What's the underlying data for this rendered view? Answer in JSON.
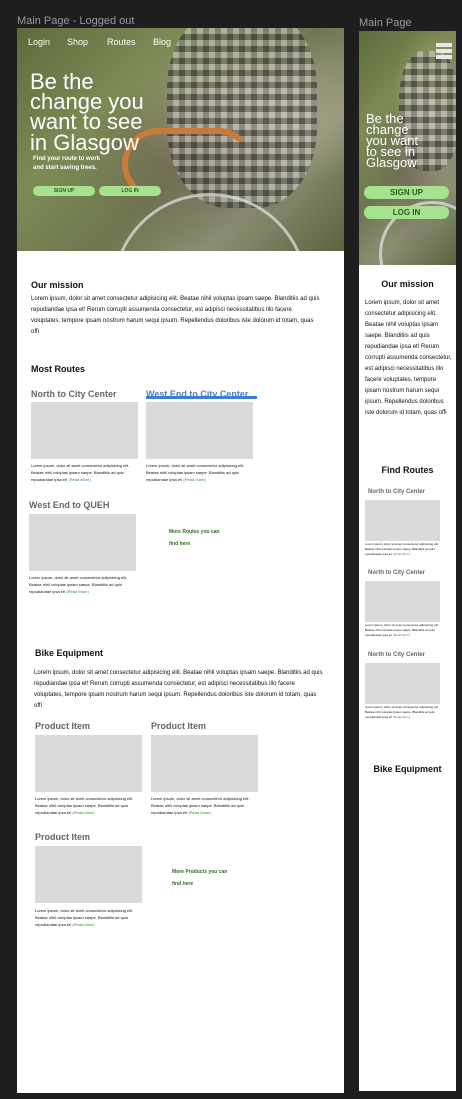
{
  "desktop": {
    "frame_label": "Main Page - Logged out",
    "nav": [
      "Login",
      "Shop",
      "Routes",
      "Blog"
    ],
    "hero": {
      "title_lines": [
        "Be the",
        "change you",
        "want to see",
        "in Glasgow"
      ],
      "subtitle_lines": [
        "Find your route to work",
        "and start saving trees."
      ],
      "signup": "SIGN UP",
      "login": "LOG IN"
    },
    "mission": {
      "title": "Our mission",
      "text": "Lorem ipsum, dolor sit amet consectetur adipisicing elit. Beatae nihil voluptas ipsam saepe. Blanditiis ad quis repudiandae ipsa et! Rerum corrupti assumenda consectetur, est adipisci necessitatibus illo facere voluptates, tempore ipsam nostrum harum sequi ipsum. Repellendus doloribus iste dolorum id totam, quas offi"
    },
    "routes": {
      "title": "Most Routes",
      "cards": [
        {
          "title": "North to City Center",
          "text": "Lorem ipsum, dolor sit amet consectetur adipisicing elit. Beatae nihil voluptas ipsam saepe. Blanditiis ad quis repudiandae ipsa et! ",
          "read_more": "(Read More)"
        },
        {
          "title": "West End to City Center",
          "text": "Lorem ipsum, dolor sit amet consectetur adipisicing elit. Beatae nihil voluptas ipsam saepe. Blanditiis ad quis repudiandae ipsa et! ",
          "read_more": "(Read More)"
        },
        {
          "title": "West End to QUEH",
          "text": "Lorem ipsum, dolor sit amet consectetur adipisicing elit. Beatae nihil voluptas ipsam saepe. Blanditiis ad quis repudiandae ipsa et! ",
          "read_more": "(Read More)"
        }
      ],
      "more_lines": [
        "More Routes you can",
        "find here"
      ]
    },
    "equipment": {
      "title": "Bike Equipment",
      "text": "Lorem ipsum, dolor sit amet consectetur adipisicing elit. Beatae nihil voluptas ipsam saepe. Blanditiis ad quis repudiandae ipsa et! Rerum corrupti assumenda consectetur, est adipisci necessitatibus illo facere voluptates, tempore ipsam nostrum harum sequi ipsum. Repellendus doloribus iste dolorum id totam, quas offi",
      "cards": [
        {
          "title": "Product Item",
          "text": "Lorem ipsum, dolor sit amet consectetur adipisicing elit. Beatae nihil voluptas ipsam saepe. Blanditiis ad quis repudiandae ipsa et! ",
          "read_more": "(Read More)"
        },
        {
          "title": "Product Item",
          "text": "Lorem ipsum, dolor sit amet consectetur adipisicing elit. Beatae nihil voluptas ipsam saepe. Blanditiis ad quis repudiandae ipsa et! ",
          "read_more": "(Read More)"
        },
        {
          "title": "Product Item",
          "text": "Lorem ipsum, dolor sit amet consectetur adipisicing elit. Beatae nihil voluptas ipsam saepe. Blanditiis ad quis repudiandae ipsa et! ",
          "read_more": "(Read More)"
        }
      ],
      "more_lines": [
        "More Products you can",
        "find here"
      ]
    }
  },
  "mobile": {
    "frame_label": "Main Page",
    "menu_icon": "hamburger-icon",
    "hero": {
      "title_lines": [
        "Be the",
        "change",
        "you want",
        "to see in",
        "Glasgow"
      ],
      "signup": "SIGN UP",
      "login": "LOG IN"
    },
    "mission": {
      "title": "Our mission",
      "text": "Lorem ipsum, dolor sit amet consectetur adipisicing elit. Beatae nihil voluptas ipsam saepe. Blanditiis ad quis repudiandae ipsa et! Rerum corrupti assumenda consectetur, est adipisci necessitatibus illo facere voluptates, tempore ipsam nostrum harum sequi ipsum. Repellendus doloribus iste dolorum id totam, quas offi"
    },
    "routes": {
      "title": "Find Routes",
      "cards": [
        {
          "title": "North to City Center",
          "text": "Lorem ipsum, dolor sit amet consectetur adipisicing elit. Beatae nihil voluptas ipsam saepe. Blanditiis ad quis repudiandae ipsa et! ",
          "read_more": "(Read More)"
        },
        {
          "title": "North to City Center",
          "text": "Lorem ipsum, dolor sit amet consectetur adipisicing elit. Beatae nihil voluptas ipsam saepe. Blanditiis ad quis repudiandae ipsa et! ",
          "read_more": "(Read More)"
        },
        {
          "title": "North to City Center",
          "text": "Lorem ipsum, dolor sit amet consectetur adipisicing elit. Beatae nihil voluptas ipsam saepe. Blanditiis ad quis repudiandae ipsa et! ",
          "read_more": "(Read More)"
        }
      ]
    },
    "equipment": {
      "title": "Bike Equipment"
    }
  },
  "colors": {
    "canvas": "#1e1e1e",
    "button": "#a5e38f",
    "button_text": "#2d5a20",
    "link": "#3a8a3a",
    "underline": "#3b7dd8",
    "placeholder": "#dadada"
  }
}
